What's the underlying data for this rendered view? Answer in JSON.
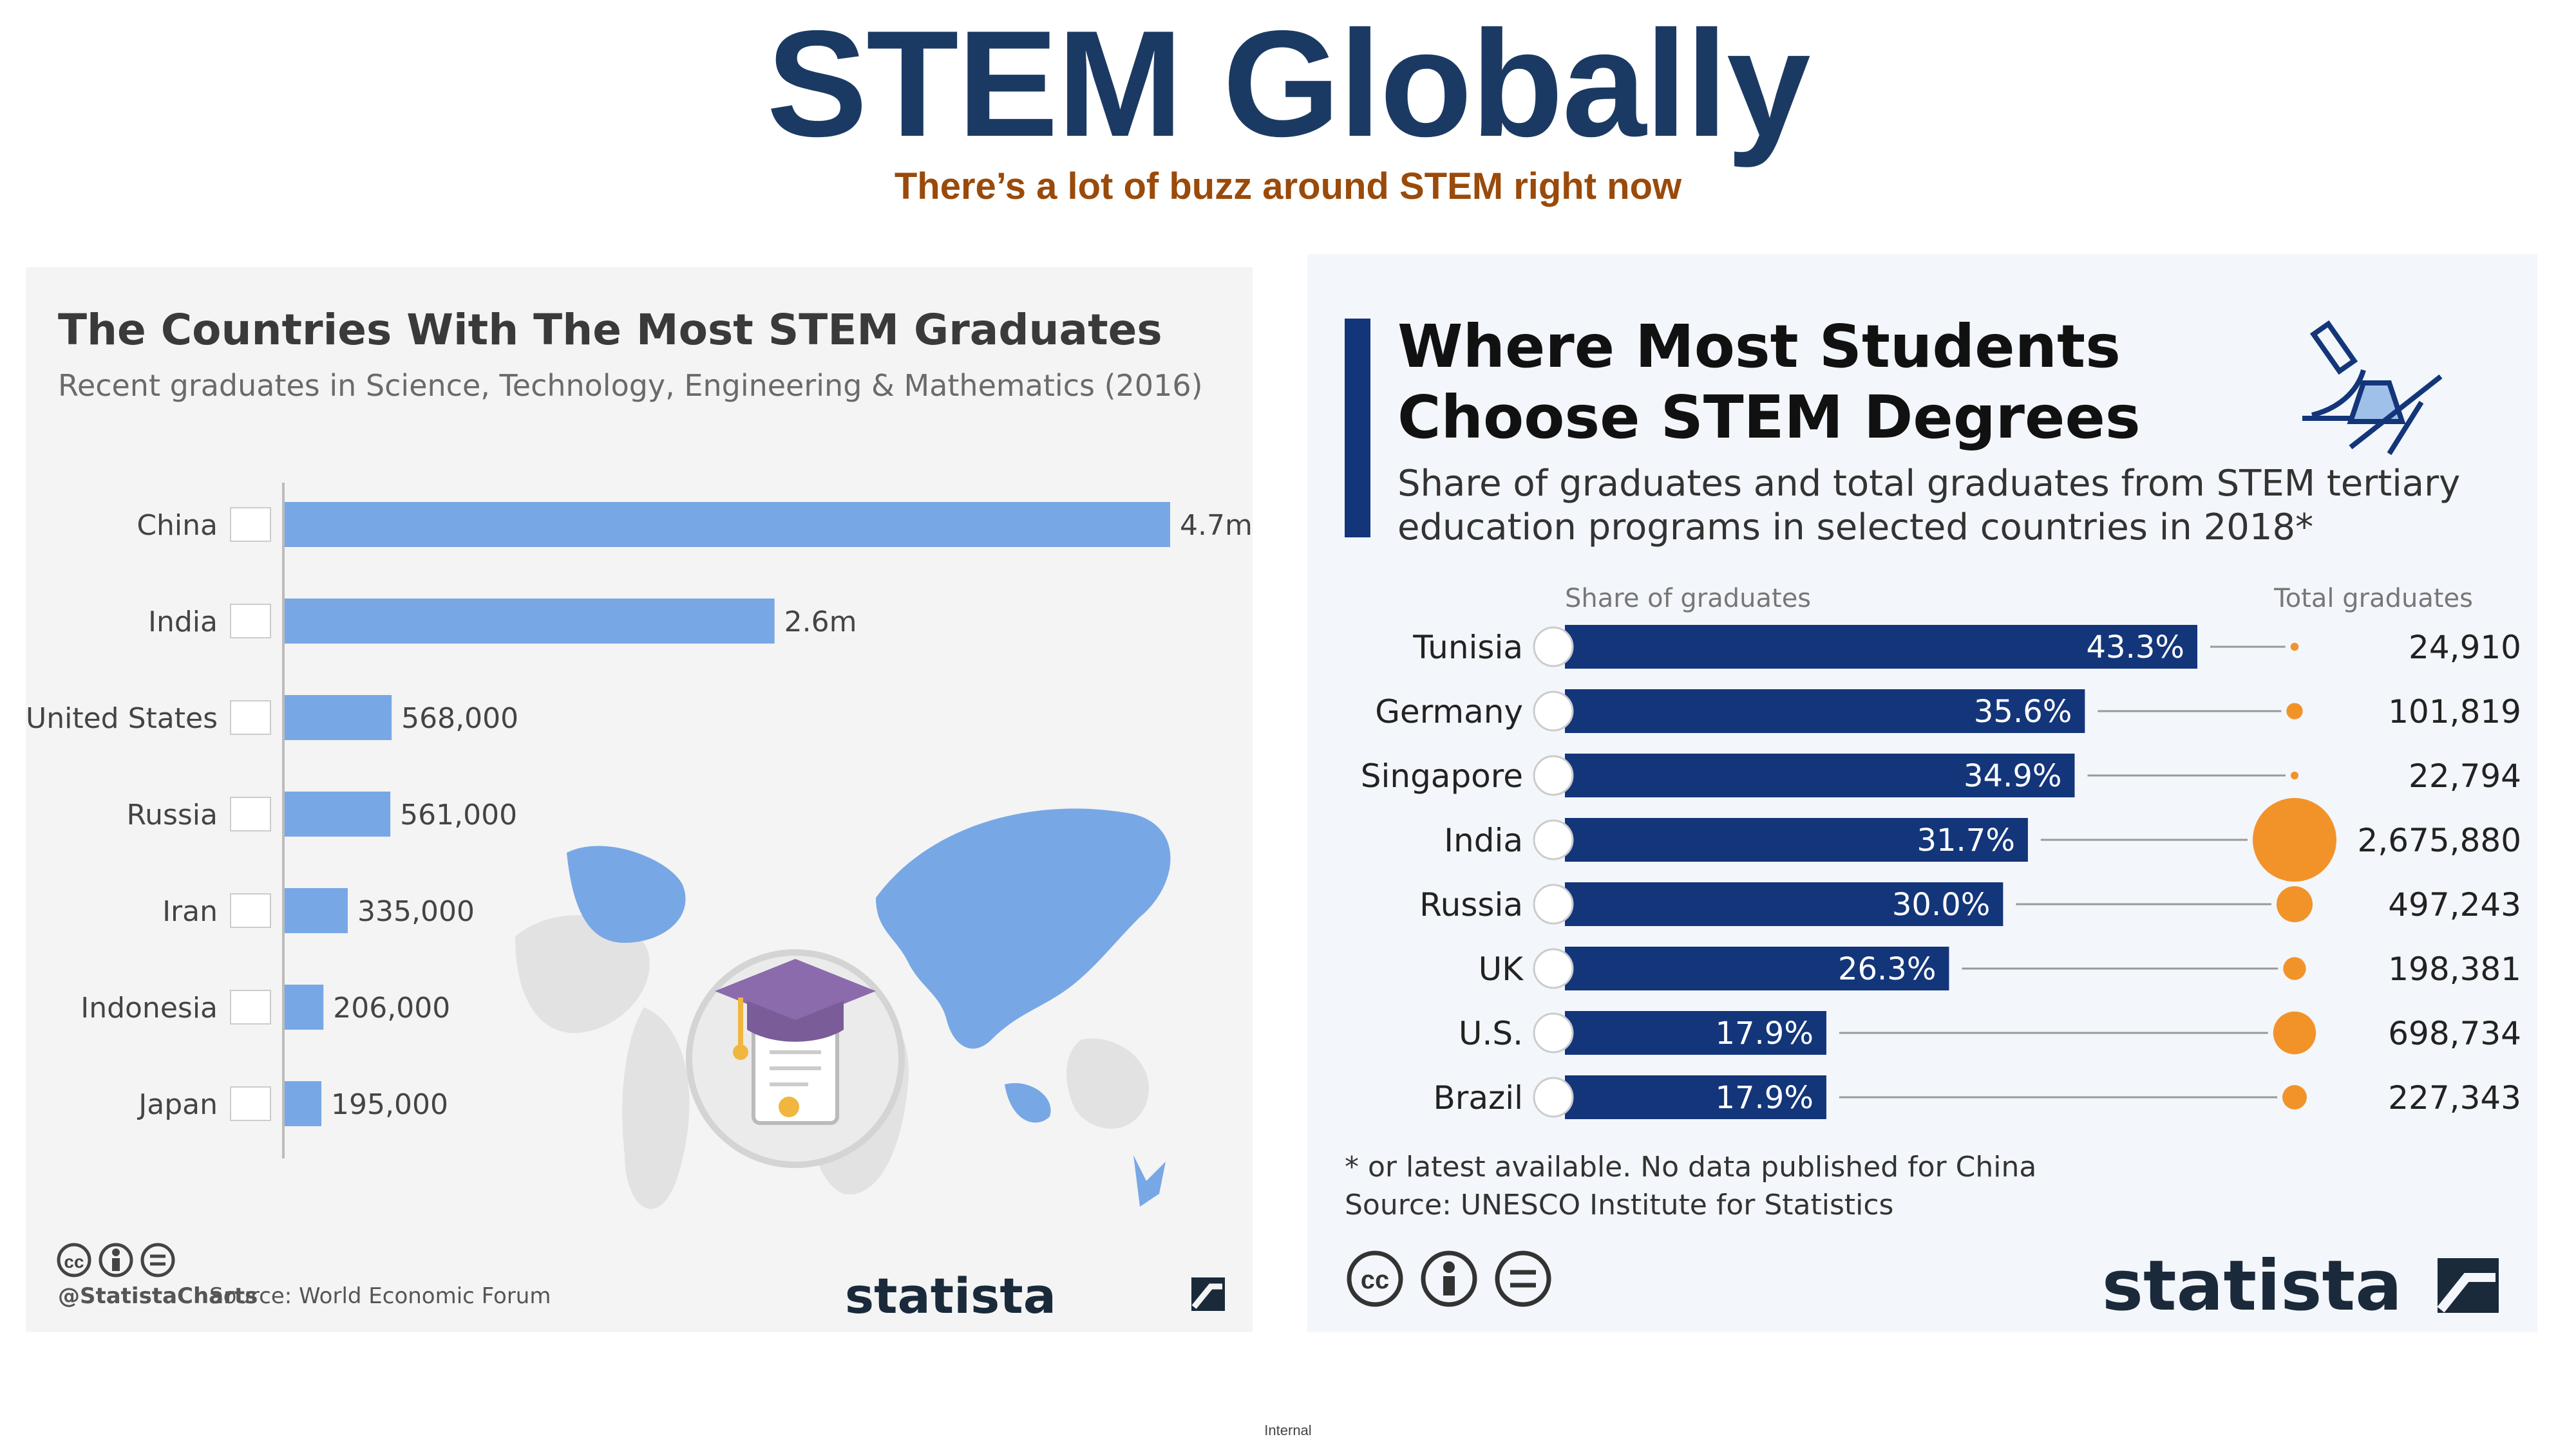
{
  "slide": {
    "title": "STEM Globally",
    "subtitle": "There’s a lot of buzz around STEM right now",
    "footer_label": "Internal"
  },
  "colors": {
    "title": "#1b3a63",
    "subtitle": "#9a4a0a",
    "left_bar": "#78a7e5",
    "right_bar": "#13357a",
    "bubble": "#f2932a"
  },
  "chart_data": [
    {
      "type": "bar",
      "orientation": "horizontal",
      "title": "The Countries With The Most STEM Graduates",
      "subtitle": "Recent graduates in Science, Technology, Engineering & Mathematics (2016)",
      "categories": [
        "China",
        "India",
        "United States",
        "Russia",
        "Iran",
        "Indonesia",
        "Japan"
      ],
      "values": [
        4700000,
        2600000,
        568000,
        561000,
        335000,
        206000,
        195000
      ],
      "data_labels": [
        "4.7m",
        "2.6m",
        "568,000",
        "561,000",
        "335,000",
        "206,000",
        "195,000"
      ],
      "xlim": [
        0,
        4700000
      ],
      "grid": false,
      "handle": "@StatistaCharts",
      "source": "Source: World Economic Forum",
      "brand": "statista"
    },
    {
      "type": "bar",
      "orientation": "horizontal",
      "title_lines": [
        "Where Most Students",
        "Choose STEM Degrees"
      ],
      "subtitle_lines": [
        "Share of graduates and total graduates from STEM tertiary",
        "education programs in selected countries in 2018*"
      ],
      "column_headers": [
        "Share of graduates",
        "Total graduates"
      ],
      "categories": [
        "Tunisia",
        "Germany",
        "Singapore",
        "India",
        "Russia",
        "UK",
        "U.S.",
        "Brazil"
      ],
      "series": [
        {
          "name": "Share of graduates",
          "values": [
            43.3,
            35.6,
            34.9,
            31.7,
            30.0,
            26.3,
            17.9,
            17.9
          ],
          "unit": "%"
        },
        {
          "name": "Total graduates",
          "values": [
            24910,
            101819,
            22794,
            2675880,
            497243,
            198381,
            698734,
            227343
          ]
        }
      ],
      "pct_labels": [
        "43.3%",
        "35.6%",
        "34.9%",
        "31.7%",
        "30.0%",
        "26.3%",
        "17.9%",
        "17.9%"
      ],
      "total_labels": [
        "24,910",
        "101,819",
        "22,794",
        "2,675,880",
        "497,243",
        "198,381",
        "698,734",
        "227,343"
      ],
      "xlim": [
        0,
        43.3
      ],
      "grid": false,
      "footnote": "* or latest available. No data published for China",
      "source": "Source: UNESCO Institute for Statistics",
      "brand": "statista"
    }
  ]
}
